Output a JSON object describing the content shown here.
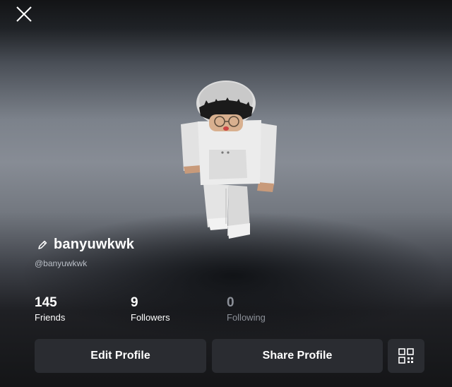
{
  "header": {
    "close_icon": "close-icon"
  },
  "profile": {
    "display_name": "banyuwkwk",
    "username": "@banyuwkwk",
    "edit_icon": "pencil-icon"
  },
  "stats": [
    {
      "count": "145",
      "label": "Friends"
    },
    {
      "count": "9",
      "label": "Followers"
    },
    {
      "count": "0",
      "label": "Following"
    }
  ],
  "actions": {
    "edit_label": "Edit Profile",
    "share_label": "Share Profile",
    "qr_icon": "qr-code-icon"
  },
  "colors": {
    "button_bg": "#2a2c31",
    "dim_text": "#8c9098"
  }
}
